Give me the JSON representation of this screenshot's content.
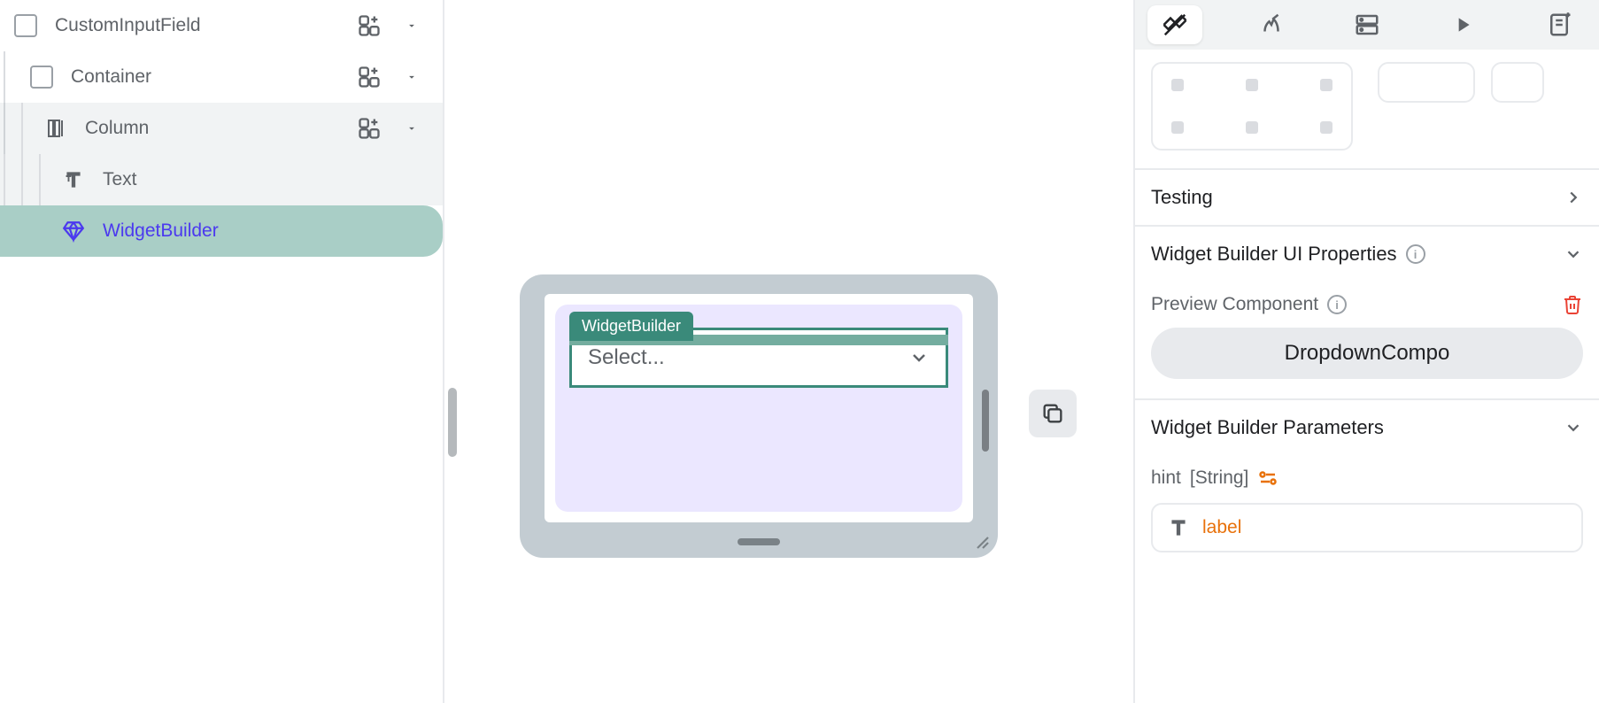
{
  "tree": {
    "root_label": "CustomInputField",
    "container_label": "Container",
    "column_label": "Column",
    "text_label": "Text",
    "widgetbuilder_label": "WidgetBuilder"
  },
  "canvas": {
    "selected_tag": "WidgetBuilder",
    "select_placeholder": "Select..."
  },
  "props": {
    "testing_label": "Testing",
    "ui_props_label": "Widget Builder UI Properties",
    "preview_label": "Preview Component",
    "preview_component": "DropdownCompo",
    "params_label": "Widget Builder Parameters",
    "param_name": "hint",
    "param_type": "[String]",
    "param_value": "label"
  }
}
